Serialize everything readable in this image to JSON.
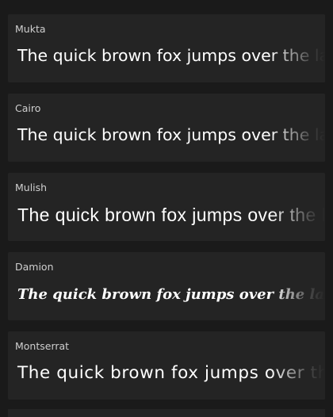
{
  "fonts": [
    {
      "name": "Mukta",
      "sample": "The quick brown fox jumps over the lazy dog"
    },
    {
      "name": "Cairo",
      "sample": "The quick brown fox jumps over the lazy dog"
    },
    {
      "name": "Mulish",
      "sample": "The quick brown fox jumps over the lazy dog"
    },
    {
      "name": "Damion",
      "sample": "The quick brown fox jumps over the lazy dog"
    },
    {
      "name": "Montserrat",
      "sample": "The quick brown fox jumps over the lazy dog"
    }
  ],
  "colors": {
    "background": "#1a1a1a",
    "card": "#242424",
    "name_text": "#cfcfcf",
    "sample_text": "#ffffff"
  }
}
